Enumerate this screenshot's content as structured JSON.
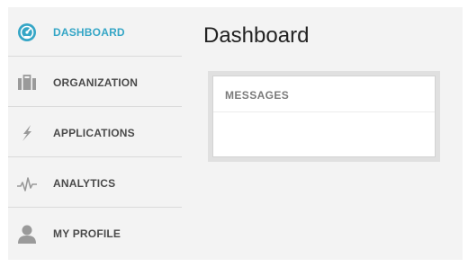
{
  "colors": {
    "accent": "#35a6c6",
    "icon_gray": "#9a9a9a",
    "text": "#4a4a4a",
    "background": "#f3f3f3"
  },
  "sidebar": {
    "items": [
      {
        "label": "DASHBOARD",
        "icon": "dashboard-icon",
        "active": true
      },
      {
        "label": "ORGANIZATION",
        "icon": "briefcase-icon",
        "active": false
      },
      {
        "label": "APPLICATIONS",
        "icon": "lightning-icon",
        "active": false
      },
      {
        "label": "ANALYTICS",
        "icon": "pulse-icon",
        "active": false
      },
      {
        "label": "MY PROFILE",
        "icon": "person-icon",
        "active": false
      }
    ]
  },
  "main": {
    "title": "Dashboard",
    "panels": [
      {
        "title": "MESSAGES"
      }
    ]
  }
}
